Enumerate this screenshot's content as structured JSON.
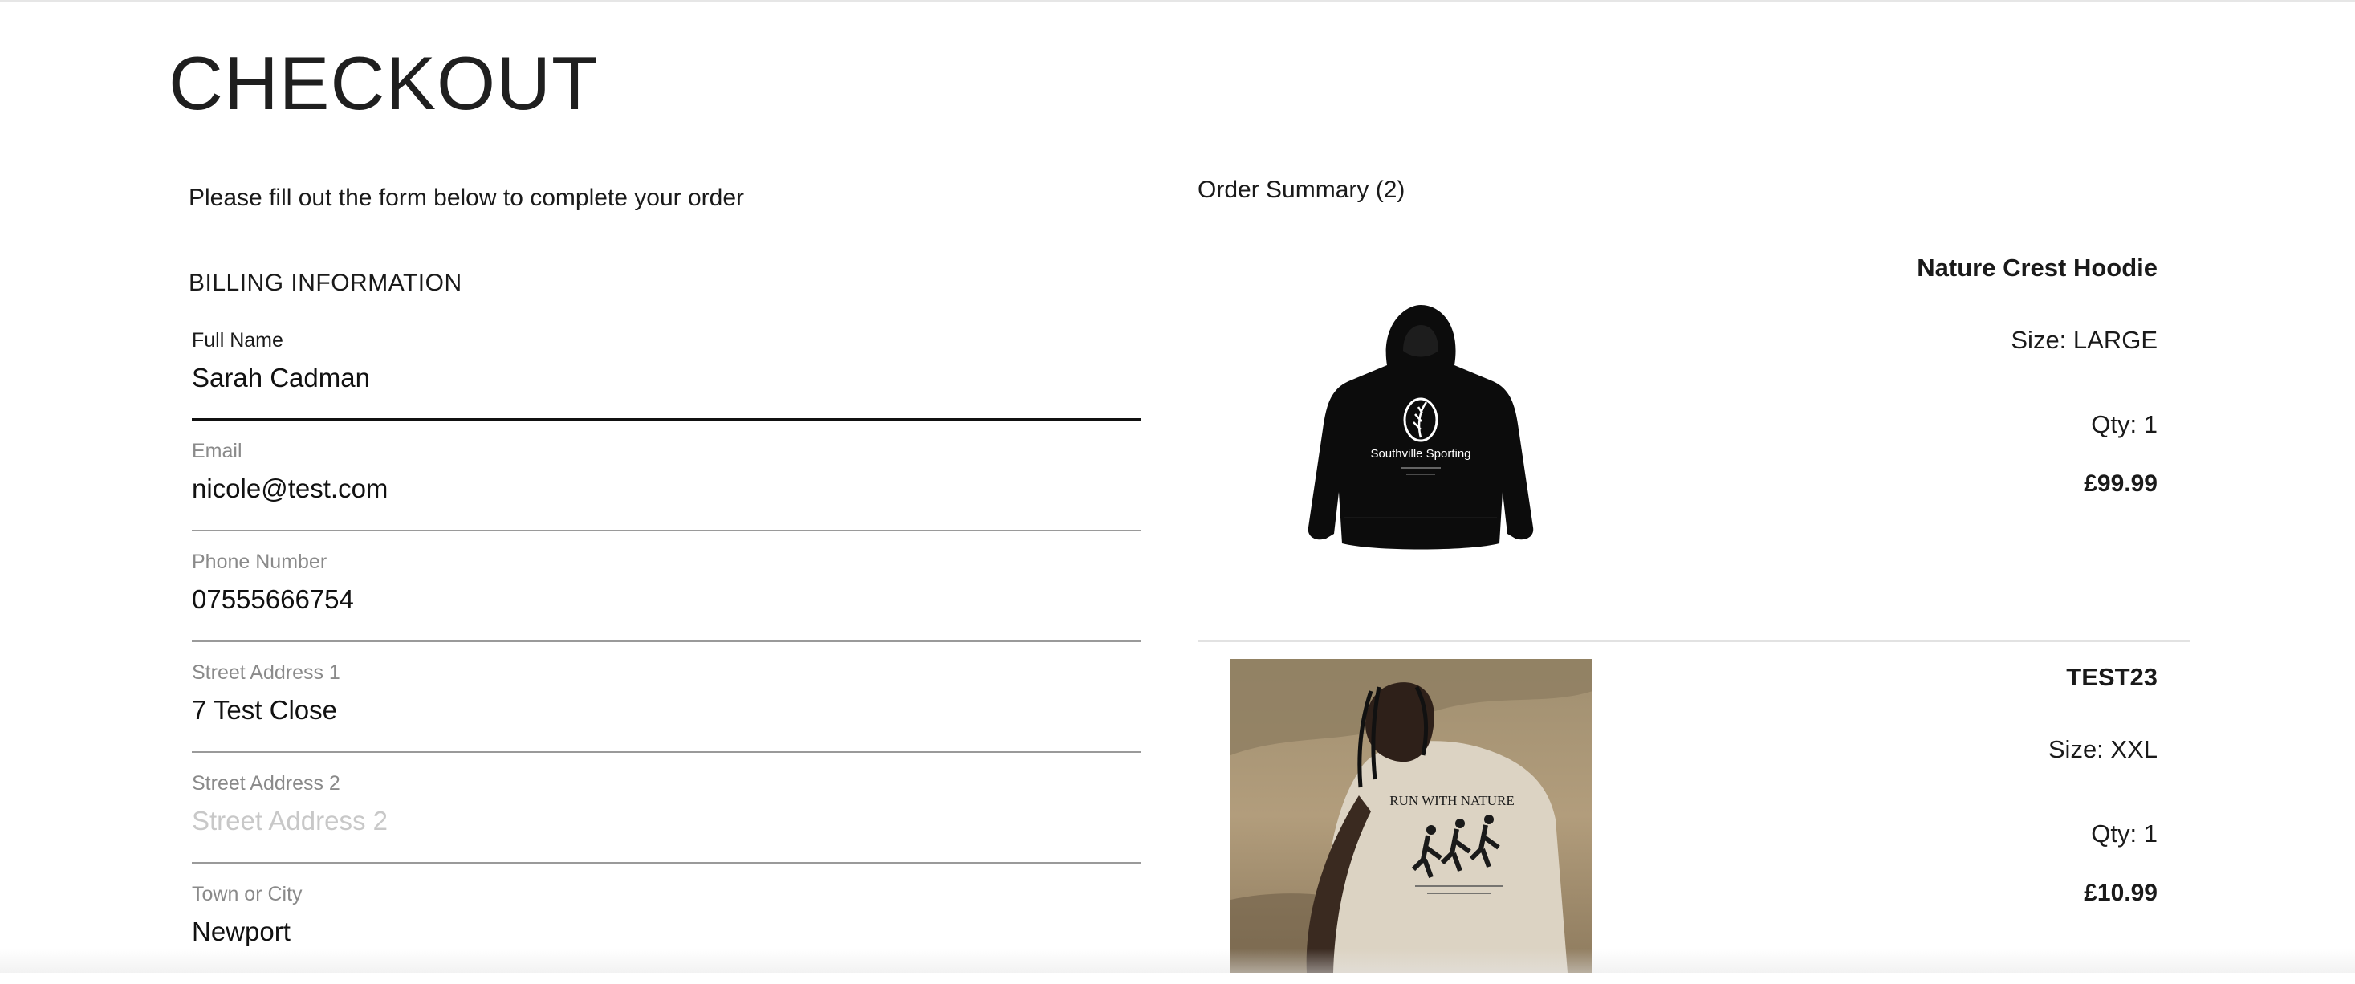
{
  "page": {
    "title": "CHECKOUT",
    "intro": "Please fill out the form below to complete your order"
  },
  "billing": {
    "section_title": "BILLING INFORMATION",
    "fields": [
      {
        "label": "Full Name",
        "value": "Sarah Cadman",
        "placeholder": "Full Name"
      },
      {
        "label": "Email",
        "value": "nicole@test.com",
        "placeholder": "Email"
      },
      {
        "label": "Phone Number",
        "value": "07555666754",
        "placeholder": "Phone Number"
      },
      {
        "label": "Street Address 1",
        "value": "7 Test Close",
        "placeholder": "Street Address 1"
      },
      {
        "label": "Street Address 2",
        "value": "",
        "placeholder": "Street Address 2"
      },
      {
        "label": "Town or City",
        "value": "Newport",
        "placeholder": "Town or City"
      }
    ]
  },
  "summary": {
    "title": "Order Summary (2)",
    "items": [
      {
        "name": "Nature Crest Hoodie",
        "size": "Size: LARGE",
        "qty": "Qty: 1",
        "price": "£99.99",
        "image_icon": "hoodie-product-image",
        "print_text": "Southville Sporting"
      },
      {
        "name": "TEST23",
        "size": "Size: XXL",
        "qty": "Qty: 1",
        "price": "£10.99",
        "image_icon": "tshirt-model-product-image",
        "print_text": "RUN WITH NATURE"
      }
    ]
  },
  "colors": {
    "text": "#1a1a1a",
    "label": "#8a8a8a",
    "placeholder": "#c8c8c8",
    "field_line": "#9a9a9a",
    "active_line": "#111111"
  }
}
